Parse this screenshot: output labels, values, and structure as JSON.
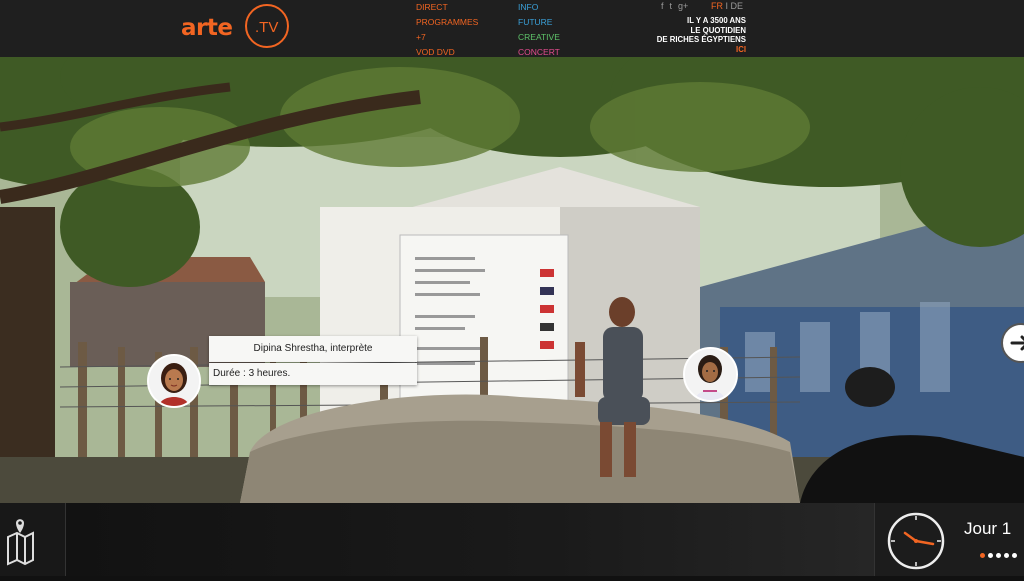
{
  "brand": {
    "word": "arte",
    "suffix": ".TV",
    "accent": "#f26522"
  },
  "nav_primary": [
    "DIRECT",
    "PROGRAMMES",
    "+7",
    "VOD DVD"
  ],
  "nav_secondary": [
    {
      "label": "INFO",
      "color": "#3aa0d8"
    },
    {
      "label": "FUTURE",
      "color": "#3aa0d8"
    },
    {
      "label": "CREATIVE",
      "color": "#5ec36a"
    },
    {
      "label": "CONCERT",
      "color": "#e44c8f"
    }
  ],
  "social": {
    "icons": [
      "facebook-icon",
      "twitter-icon",
      "google-plus-icon"
    ],
    "glyphs": [
      "f",
      "t",
      "g+"
    ]
  },
  "lang": {
    "active": "FR",
    "separator": "I",
    "other": "DE"
  },
  "promo": {
    "line1": "IL Y A 3500 ANS",
    "line2": "LE QUOTIDIEN",
    "line3": "DE RICHES ÉGYPTIENS",
    "cta": "ICI"
  },
  "character": {
    "name": "Dipina Shrestha, interprète",
    "duration": "Durée : 3 heures."
  },
  "bottom": {
    "day": "Jour 1",
    "day_dots": 5,
    "active_dot": 0
  }
}
